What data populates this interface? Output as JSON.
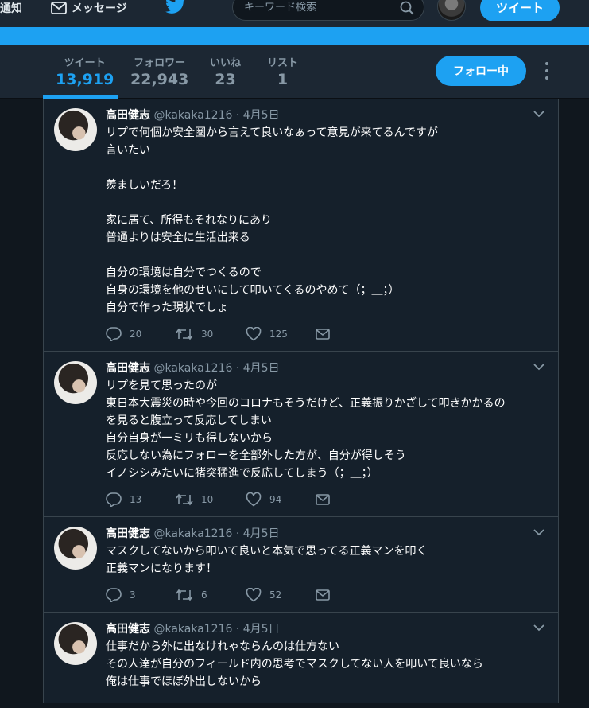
{
  "nav": {
    "notifications": "通知",
    "messages": "メッセージ",
    "search_placeholder": "キーワード検索",
    "tweet_button": "ツイート"
  },
  "profile_nav": {
    "stats": [
      {
        "label": "ツイート",
        "value": "13,919"
      },
      {
        "label": "フォロワー",
        "value": "22,943"
      },
      {
        "label": "いいね",
        "value": "23"
      },
      {
        "label": "リスト",
        "value": "1"
      }
    ],
    "follow_button": "フォロー中"
  },
  "colors": {
    "accent": "#1da1f2",
    "background": "#10171e",
    "card": "#15202b",
    "text_secondary": "#8899a6"
  },
  "tweets": [
    {
      "name": "高田健志",
      "handle": "@kakaka1216",
      "date": "· 4月5日",
      "lines": [
        "リプで何個か安全圏から言えて良いなぁって意見が来てるんですが",
        "言いたい",
        "",
        "羨ましいだろ！",
        "",
        "家に居て、所得もそれなりにあり",
        "普通よりは安全に生活出来る",
        "",
        "自分の環境は自分でつくるので",
        "自身の環境を他のせいにして叩いてくるのやめて（；＿；）",
        "自分で作った現状でしょ"
      ],
      "replies": "20",
      "retweets": "30",
      "likes": "125"
    },
    {
      "name": "高田健志",
      "handle": "@kakaka1216",
      "date": "· 4月5日",
      "lines": [
        "リプを見て思ったのが",
        "東日本大震災の時や今回のコロナもそうだけど、正義振りかざして叩きかかるの",
        "を見ると腹立って反応してしまい",
        "自分自身が一ミリも得しないから",
        "反応しない為にフォローを全部外した方が、自分が得しそう",
        "イノシシみたいに猪突猛進で反応してしまう（；＿；）"
      ],
      "replies": "13",
      "retweets": "10",
      "likes": "94"
    },
    {
      "name": "高田健志",
      "handle": "@kakaka1216",
      "date": "· 4月5日",
      "lines": [
        "マスクしてないから叩いて良いと本気で思ってる正義マンを叩く",
        "正義マンになります！"
      ],
      "replies": "3",
      "retweets": "6",
      "likes": "52"
    },
    {
      "name": "高田健志",
      "handle": "@kakaka1216",
      "date": "· 4月5日",
      "lines": [
        "仕事だから外に出なけれゃならんのは仕方ない",
        "その人達が自分のフィールド内の思考でマスクしてない人を叩いて良いなら",
        "俺は仕事でほぼ外出しないから"
      ]
    }
  ]
}
